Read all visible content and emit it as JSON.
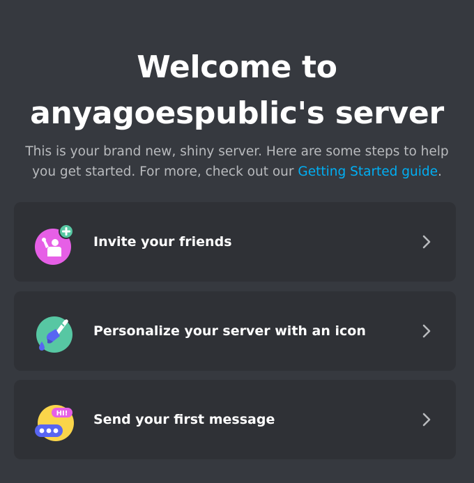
{
  "welcome": {
    "title_line1": "Welcome to",
    "title_line2": "anyagoespublic's server",
    "subtitle_line1": "This is your brand new, shiny server. Here are some steps to help",
    "subtitle_line2_prefix": "you get started. For more, check out our ",
    "guide_link": "Getting Started guide",
    "subtitle_suffix": "."
  },
  "actions": [
    {
      "label": "Invite your friends",
      "icon": "invite-friends-icon"
    },
    {
      "label": "Personalize your server with an icon",
      "icon": "paintbrush-icon"
    },
    {
      "label": "Send your first message",
      "icon": "chat-bubble-icon"
    }
  ],
  "icon_text": {
    "hi": "HI!"
  },
  "colors": {
    "background": "#36393f",
    "card": "#2f3136",
    "link": "#00aff4",
    "subtitle": "#b9bbbe",
    "invite_icon": "#e65fe6",
    "personalize_icon": "#57c7a3",
    "message_icon": "#fad54a"
  }
}
